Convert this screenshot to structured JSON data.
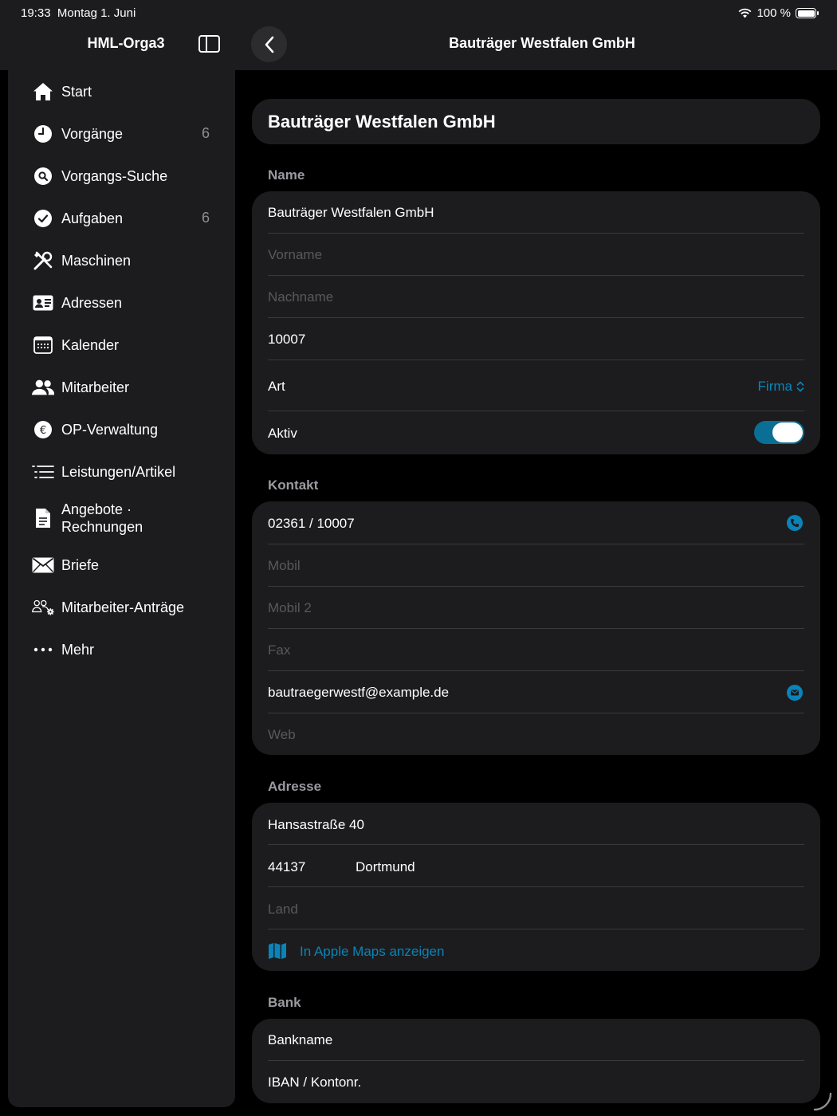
{
  "status": {
    "time": "19:33",
    "date": "Montag 1. Juni",
    "battery": "100 %"
  },
  "sidebar": {
    "title": "HML-Orga3",
    "items": [
      {
        "label": "Start",
        "icon": "house-icon",
        "count": ""
      },
      {
        "label": "Vorgänge",
        "icon": "clock-icon",
        "count": "6"
      },
      {
        "label": "Vorgangs-Suche",
        "icon": "search-icon",
        "count": ""
      },
      {
        "label": "Aufgaben",
        "icon": "checkmark-icon",
        "count": "6"
      },
      {
        "label": "Maschinen",
        "icon": "tools-icon",
        "count": ""
      },
      {
        "label": "Adressen",
        "icon": "contact-card-icon",
        "count": ""
      },
      {
        "label": "Kalender",
        "icon": "calendar-icon",
        "count": ""
      },
      {
        "label": "Mitarbeiter",
        "icon": "people-icon",
        "count": ""
      },
      {
        "label": "OP-Verwaltung",
        "icon": "euro-icon",
        "count": ""
      },
      {
        "label": "Leistungen/Artikel",
        "icon": "list-icon",
        "count": ""
      },
      {
        "label": "Angebote ·",
        "label2": "Rechnungen",
        "icon": "document-icon",
        "count": ""
      },
      {
        "label": "Briefe",
        "icon": "envelope-icon",
        "count": ""
      },
      {
        "label": "Mitarbeiter-Anträge",
        "icon": "people-gear-icon",
        "count": ""
      },
      {
        "label": "Mehr",
        "icon": "ellipsis-icon",
        "count": ""
      }
    ]
  },
  "header": {
    "title": "Bauträger Westfalen GmbH"
  },
  "main": {
    "title": "Bauträger Westfalen GmbH",
    "name_section": {
      "heading": "Name",
      "company": "Bauträger Westfalen GmbH",
      "vorname_placeholder": "Vorname",
      "nachname_placeholder": "Nachname",
      "number": "10007",
      "art_label": "Art",
      "art_value": "Firma",
      "aktiv_label": "Aktiv",
      "aktiv_on": true
    },
    "contact_section": {
      "heading": "Kontakt",
      "phone": "02361 / 10007",
      "mobil_placeholder": "Mobil",
      "mobil2_placeholder": "Mobil 2",
      "fax_placeholder": "Fax",
      "email": "bautraegerwestf@example.de",
      "web_placeholder": "Web"
    },
    "address_section": {
      "heading": "Adresse",
      "street": "Hansastraße 40",
      "zip": "44137",
      "city": "Dortmund",
      "country_placeholder": "Land",
      "maps_link": "In Apple Maps anzeigen"
    },
    "bank_section": {
      "heading": "Bank",
      "bankname_placeholder": "Bankname",
      "iban_placeholder": "IBAN / Kontonr."
    }
  },
  "colors": {
    "accent": "#0a84b8",
    "background": "#000000",
    "card": "#1c1c1e"
  }
}
